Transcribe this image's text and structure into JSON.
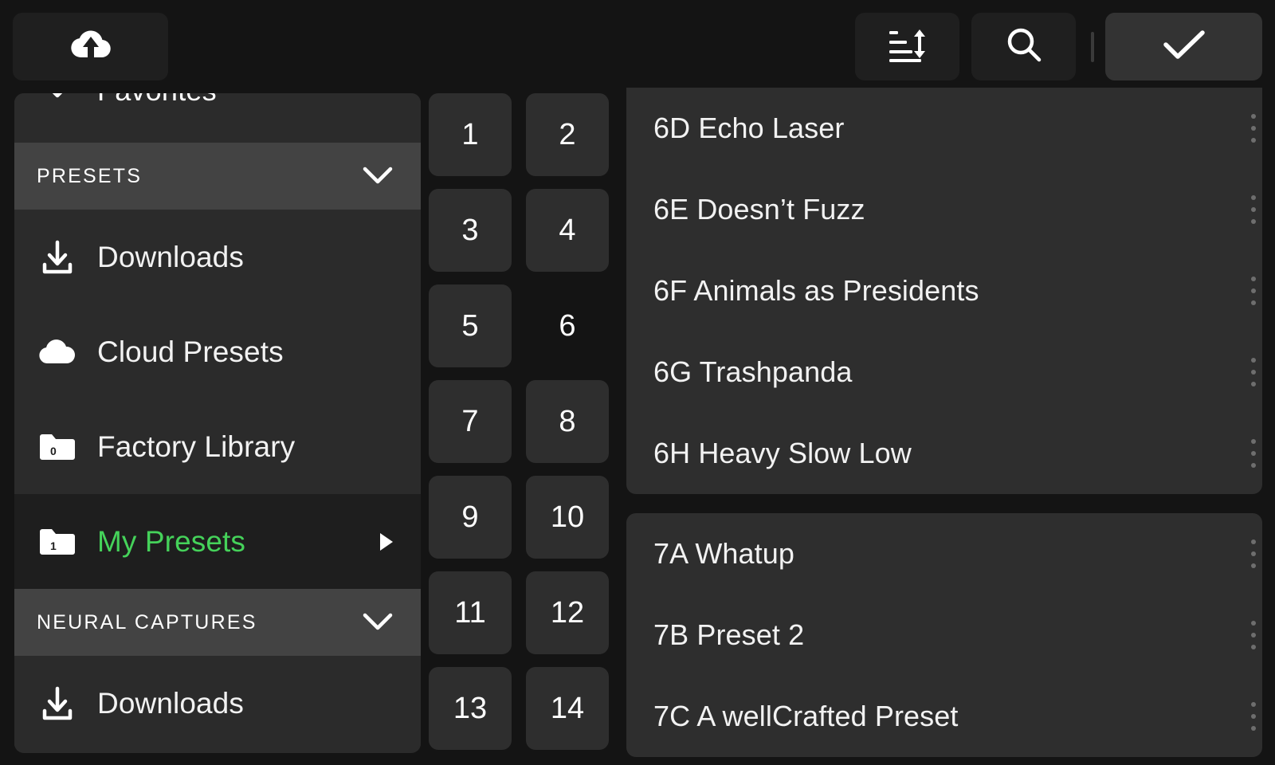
{
  "toolbar": {
    "upload_label": "cloud-upload",
    "sort_label": "sort",
    "search_label": "search",
    "confirm_label": "confirm-check"
  },
  "sidebar": {
    "favorites": {
      "label": "Favorites",
      "icon": "chevron-down-icon"
    },
    "sections": [
      {
        "title": "PRESETS",
        "chevron": "chevron-down-icon",
        "items": [
          {
            "label": "Downloads",
            "icon": "download-icon",
            "selected": false,
            "badge": ""
          },
          {
            "label": "Cloud Presets",
            "icon": "cloud-icon",
            "selected": false,
            "badge": ""
          },
          {
            "label": "Factory Library",
            "icon": "folder-icon",
            "selected": false,
            "badge": "0"
          },
          {
            "label": "My Presets",
            "icon": "folder-icon",
            "selected": true,
            "badge": "1",
            "arrow": "triangle-right-icon"
          }
        ]
      },
      {
        "title": "NEURAL CAPTURES",
        "chevron": "chevron-down-icon",
        "items": [
          {
            "label": "Downloads",
            "icon": "download-icon",
            "selected": false,
            "badge": ""
          }
        ]
      }
    ]
  },
  "grid": {
    "cells": [
      {
        "label": "1",
        "filled": true
      },
      {
        "label": "2",
        "filled": true
      },
      {
        "label": "3",
        "filled": true
      },
      {
        "label": "4",
        "filled": true
      },
      {
        "label": "5",
        "filled": true
      },
      {
        "label": "6",
        "filled": false
      },
      {
        "label": "7",
        "filled": true
      },
      {
        "label": "8",
        "filled": true
      },
      {
        "label": "9",
        "filled": true
      },
      {
        "label": "10",
        "filled": true
      },
      {
        "label": "11",
        "filled": true
      },
      {
        "label": "12",
        "filled": true
      },
      {
        "label": "13",
        "filled": true
      },
      {
        "label": "14",
        "filled": true
      }
    ]
  },
  "presets": {
    "menu_icon": "more-vertical-icon",
    "cards": [
      {
        "rows": [
          {
            "name": "6D Echo Laser"
          },
          {
            "name": "6E Doesn’t Fuzz"
          },
          {
            "name": "6F Animals as Presidents"
          },
          {
            "name": "6G Trashpanda"
          },
          {
            "name": "6H Heavy Slow Low"
          }
        ]
      },
      {
        "rows": [
          {
            "name": "7A Whatup"
          },
          {
            "name": "7B Preset 2"
          },
          {
            "name": "7C A wellCrafted Preset"
          }
        ]
      }
    ]
  },
  "colors": {
    "page_bg": "#141414",
    "panel_bg": "#2b2b2b",
    "card_bg": "#2e2e2e",
    "section_header_bg": "#434343",
    "selected_row_bg": "#1e1e1e",
    "accent_green": "#45d25a",
    "toolbar_btn_bg": "#1f1f1f",
    "confirm_btn_bg": "#333333",
    "dot_gray": "#6e6e6e"
  }
}
